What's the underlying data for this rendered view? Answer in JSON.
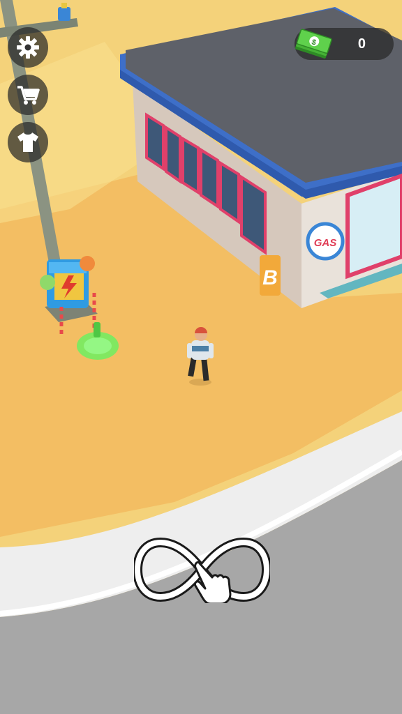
{
  "hud": {
    "settings_icon": "gear-icon",
    "shop_icon": "shopping-cart-icon",
    "skins_icon": "tshirt-icon",
    "money": {
      "icon": "cash-stack-icon",
      "value": "0"
    }
  },
  "world": {
    "station_sign": "GAS",
    "door_sign": "B",
    "power_box_icon": "lightning-bolt-icon"
  },
  "tutorial": {
    "gesture_icon": "infinity-swipe-hand-icon"
  },
  "colors": {
    "ground": "#f3d37a",
    "road": "#a8a8a8",
    "sidewalk": "#f1f1f1",
    "roof": "#5e6068",
    "roof_trim": "#3f6dc7",
    "window_frame": "#e0406a",
    "highlight_green": "#6cf060"
  }
}
